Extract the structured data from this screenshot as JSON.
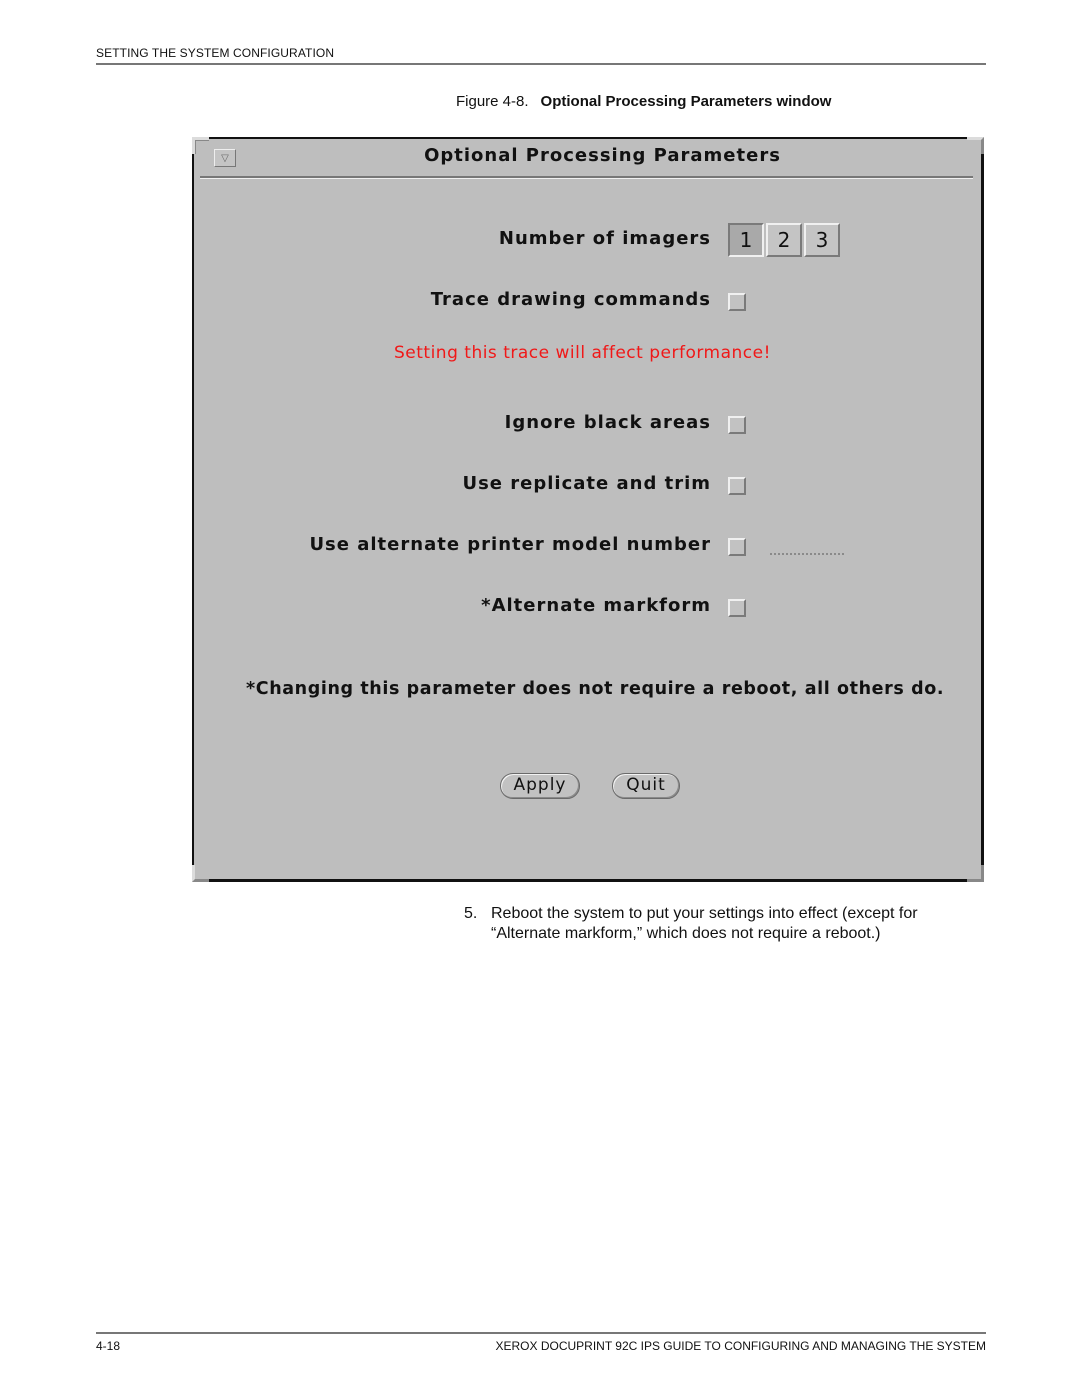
{
  "page": {
    "running_head": "SETTING THE SYSTEM CONFIGURATION",
    "figure_number": "Figure 4-8.",
    "figure_title": "Optional Processing Parameters window",
    "footer_left": "4-18",
    "footer_right": "XEROX DOCUPRINT 92C IPS GUIDE TO CONFIGURING AND MANAGING THE SYSTEM"
  },
  "window": {
    "title": "Optional Processing Parameters",
    "menu_icon": "triangle-down-icon",
    "imagers": {
      "label": "Number of imagers",
      "options": [
        "1",
        "2",
        "3"
      ],
      "selected": "1"
    },
    "trace": {
      "label": "Trace drawing commands",
      "checked": false,
      "warning": "Setting this trace will affect performance!",
      "warning_color": "#f01818"
    },
    "ignore_black": {
      "label": "Ignore black areas",
      "checked": false
    },
    "replicate_trim": {
      "label": "Use replicate and trim",
      "checked": false
    },
    "alt_model": {
      "label": "Use alternate printer model number",
      "checked": false,
      "value": ""
    },
    "alt_markform": {
      "label": "*Alternate markform",
      "checked": false
    },
    "note": "*Changing this parameter does not require a reboot, all others do.",
    "buttons": {
      "apply": "Apply",
      "quit": "Quit"
    },
    "background_color": "#bebebe"
  },
  "step": {
    "number": "5.",
    "text": "Reboot the system to put your settings into effect (except for “Alternate markform,” which does not require a reboot.)"
  }
}
